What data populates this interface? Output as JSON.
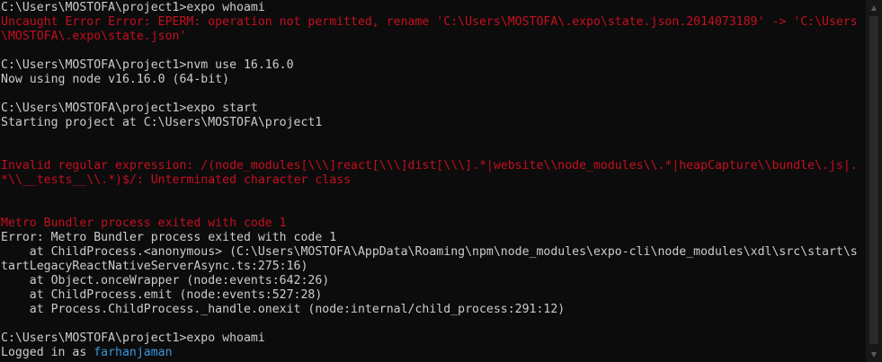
{
  "terminal": {
    "lines": [
      {
        "text": "C:\\Users\\MOSTOFA\\project1>expo whoami",
        "color": "default"
      },
      {
        "text": "Uncaught Error Error: EPERM: operation not permitted, rename 'C:\\Users\\MOSTOFA\\.expo\\state.json.2014073189' -> 'C:\\Users",
        "color": "red"
      },
      {
        "text": "\\MOSTOFA\\.expo\\state.json'",
        "color": "red"
      },
      {
        "text": "",
        "color": "default"
      },
      {
        "text": "C:\\Users\\MOSTOFA\\project1>nvm use 16.16.0",
        "color": "default"
      },
      {
        "text": "Now using node v16.16.0 (64-bit)",
        "color": "default"
      },
      {
        "text": "",
        "color": "default"
      },
      {
        "text": "C:\\Users\\MOSTOFA\\project1>expo start",
        "color": "default"
      },
      {
        "text": "Starting project at C:\\Users\\MOSTOFA\\project1",
        "color": "default"
      },
      {
        "text": "",
        "color": "default"
      },
      {
        "text": "",
        "color": "default"
      },
      {
        "text": "Invalid regular expression: /(node_modules[\\\\\\]react[\\\\\\]dist[\\\\\\].*|website\\\\node_modules\\\\.*|heapCapture\\\\bundle\\.js|.",
        "color": "red"
      },
      {
        "text": "*\\\\__tests__\\\\.*)$/: Unterminated character class",
        "color": "red"
      },
      {
        "text": "",
        "color": "default"
      },
      {
        "text": "",
        "color": "default"
      },
      {
        "text": "Metro Bundler process exited with code 1",
        "color": "red"
      },
      {
        "text": "Error: Metro Bundler process exited with code 1",
        "color": "default"
      },
      {
        "text": "    at ChildProcess.<anonymous> (C:\\Users\\MOSTOFA\\AppData\\Roaming\\npm\\node_modules\\expo-cli\\node_modules\\xdl\\src\\start\\s",
        "color": "default"
      },
      {
        "text": "tartLegacyReactNativeServerAsync.ts:275:16)",
        "color": "default"
      },
      {
        "text": "    at Object.onceWrapper (node:events:642:26)",
        "color": "default"
      },
      {
        "text": "    at ChildProcess.emit (node:events:527:28)",
        "color": "default"
      },
      {
        "text": "    at Process.ChildProcess._handle.onexit (node:internal/child_process:291:12)",
        "color": "default"
      },
      {
        "text": "",
        "color": "default"
      },
      {
        "text": "C:\\Users\\MOSTOFA\\project1>expo whoami",
        "color": "default"
      }
    ],
    "last_line": {
      "prefix": "Logged in as ",
      "username": "farhanjaman"
    }
  },
  "colors": {
    "background": "#0c0c0c",
    "default_text": "#cccccc",
    "error_red": "#c50f1f",
    "username_cyan": "#3a96dd"
  },
  "scrollbar": {
    "up_icon": "chevron-up-icon",
    "down_icon": "chevron-down-icon"
  }
}
